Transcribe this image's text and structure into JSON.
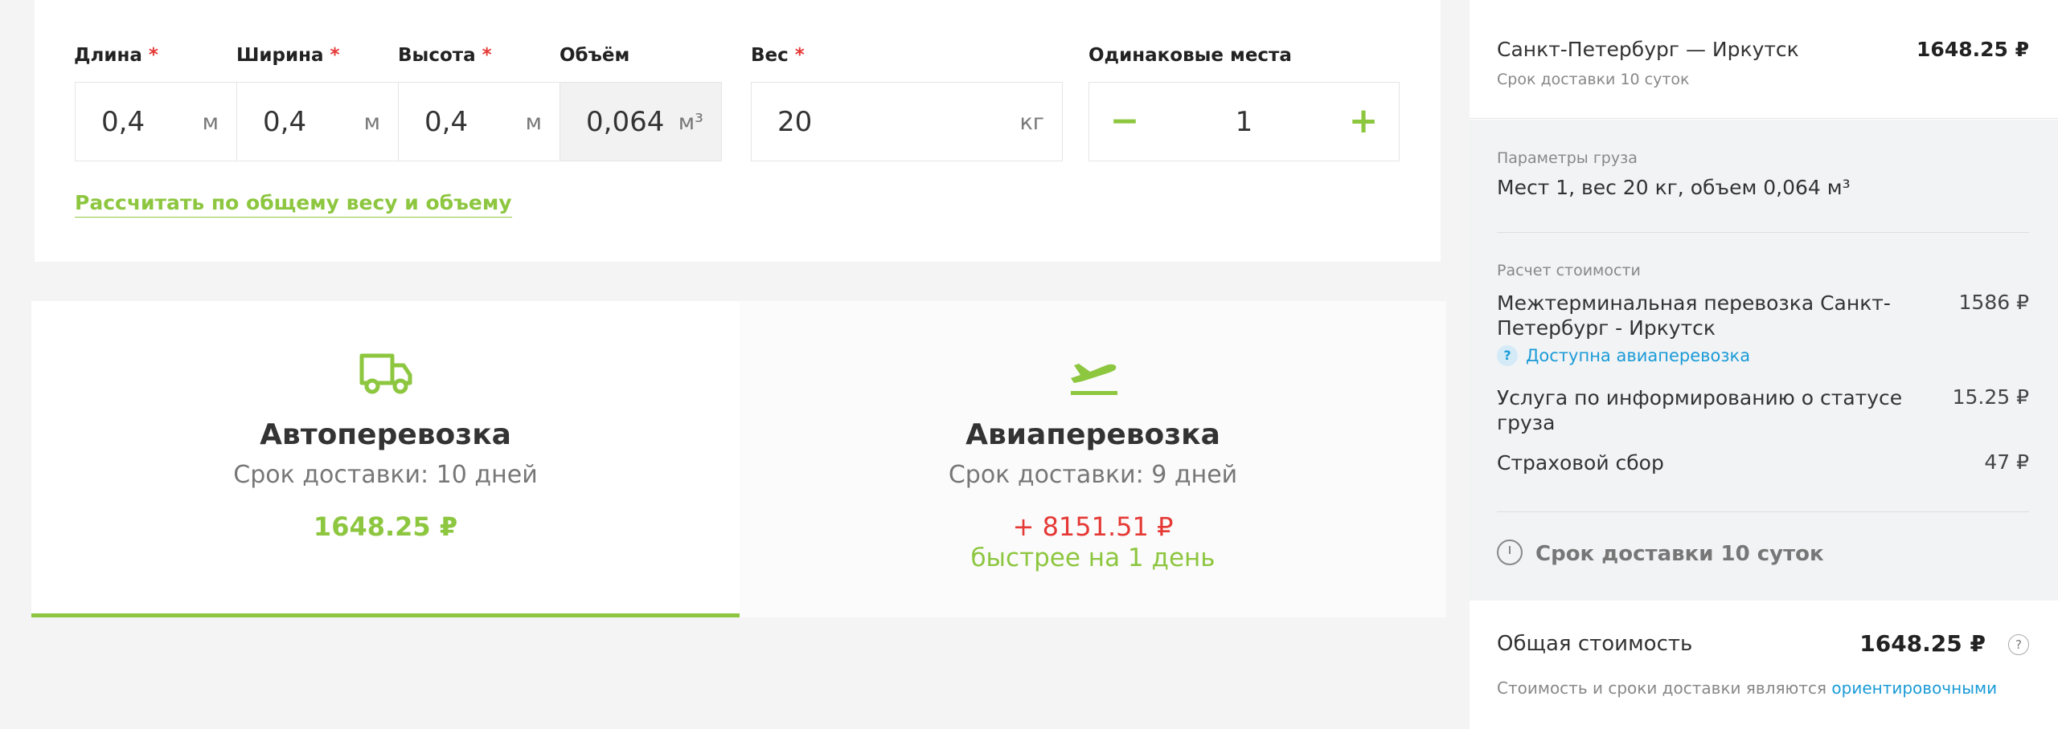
{
  "form": {
    "fields": [
      {
        "label": "Длина",
        "required": true,
        "value": "0,4",
        "unit": "м"
      },
      {
        "label": "Ширина",
        "required": true,
        "value": "0,4",
        "unit": "м"
      },
      {
        "label": "Высота",
        "required": true,
        "value": "0,4",
        "unit": "м"
      },
      {
        "label": "Объём",
        "required": false,
        "value": "0,064",
        "unit": "м³"
      },
      {
        "label": "Вес",
        "required": true,
        "value": "20",
        "unit": "кг"
      }
    ],
    "places": {
      "label": "Одинаковые места",
      "minus": "−",
      "value": "1",
      "plus": "+"
    },
    "required_mark": "*",
    "recalc_link": "Рассчитать по общему весу и объему"
  },
  "options": {
    "auto": {
      "icon": "truck-icon",
      "title": "Автоперевозка",
      "term": "Срок доставки: 10 дней",
      "price": "1648.25 ₽"
    },
    "air": {
      "icon": "airplane-takeoff-icon",
      "title": "Авиаперевозка",
      "term": "Срок доставки: 9 дней",
      "price": "+ 8151.51 ₽",
      "faster": "быстрее на 1 день"
    }
  },
  "summary": {
    "route": "Санкт-Петербург — Иркутск",
    "route_price": "1648.25 ₽",
    "route_term": "Срок доставки 10 суток",
    "cargo_label": "Параметры груза",
    "cargo_text": "Мест 1, вес 20 кг, объем 0,064 м³",
    "calc_label": "Расчет стоимости",
    "lines": [
      {
        "label": "Межтерминальная перевозка Санкт-Петербург - Иркутск",
        "price": "1586 ₽"
      },
      {
        "label": "Услуга по информированию о статусе груза",
        "price": "15.25 ₽"
      },
      {
        "label": "Страховой сбор",
        "price": "47 ₽"
      }
    ],
    "air_link": "Доступна авиаперевозка",
    "help_mark": "?",
    "delivery_term": "Срок доставки 10 суток",
    "total_label": "Общая стоимость",
    "total_price": "1648.25 ₽",
    "note": "Стоимость и сроки доставки являются",
    "note_link": "ориентировочными"
  },
  "colors": {
    "accent": "#8dc63f",
    "danger": "#e53935",
    "link": "#1a9bd7"
  }
}
